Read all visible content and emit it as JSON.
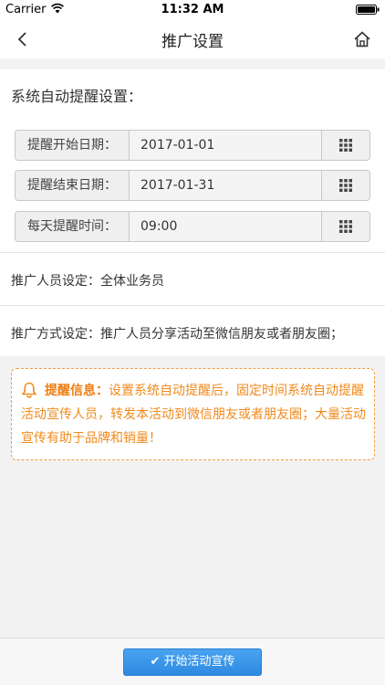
{
  "status_bar": {
    "carrier": "Carrier",
    "time": "11:32 AM"
  },
  "nav": {
    "title": "推广设置"
  },
  "reminder": {
    "section_title": "系统自动提醒设置：",
    "fields": [
      {
        "label": "提醒开始日期：",
        "value": "2017-01-01"
      },
      {
        "label": "提醒结束日期：",
        "value": "2017-01-31"
      },
      {
        "label": "每天提醒时间：",
        "value": "09:00"
      }
    ]
  },
  "promotion": {
    "staff_label": "推广人员设定：",
    "staff_value": "全体业务员",
    "method_label": "推广方式设定：",
    "method_value": "推广人员分享活动至微信朋友或者朋友圈；"
  },
  "notice": {
    "title": "提醒信息：",
    "body": "设置系统自动提醒后，固定时间系统自动提醒活动宣传人员，转发本活动到微信朋友或者朋友圈；大量活动宣传有助于品牌和销量！",
    "color": "#f08a1c"
  },
  "bottom": {
    "start_label": "开始活动宣传"
  },
  "colors": {
    "accent": "#2f8ae0",
    "notice_border": "#f39b3d"
  }
}
